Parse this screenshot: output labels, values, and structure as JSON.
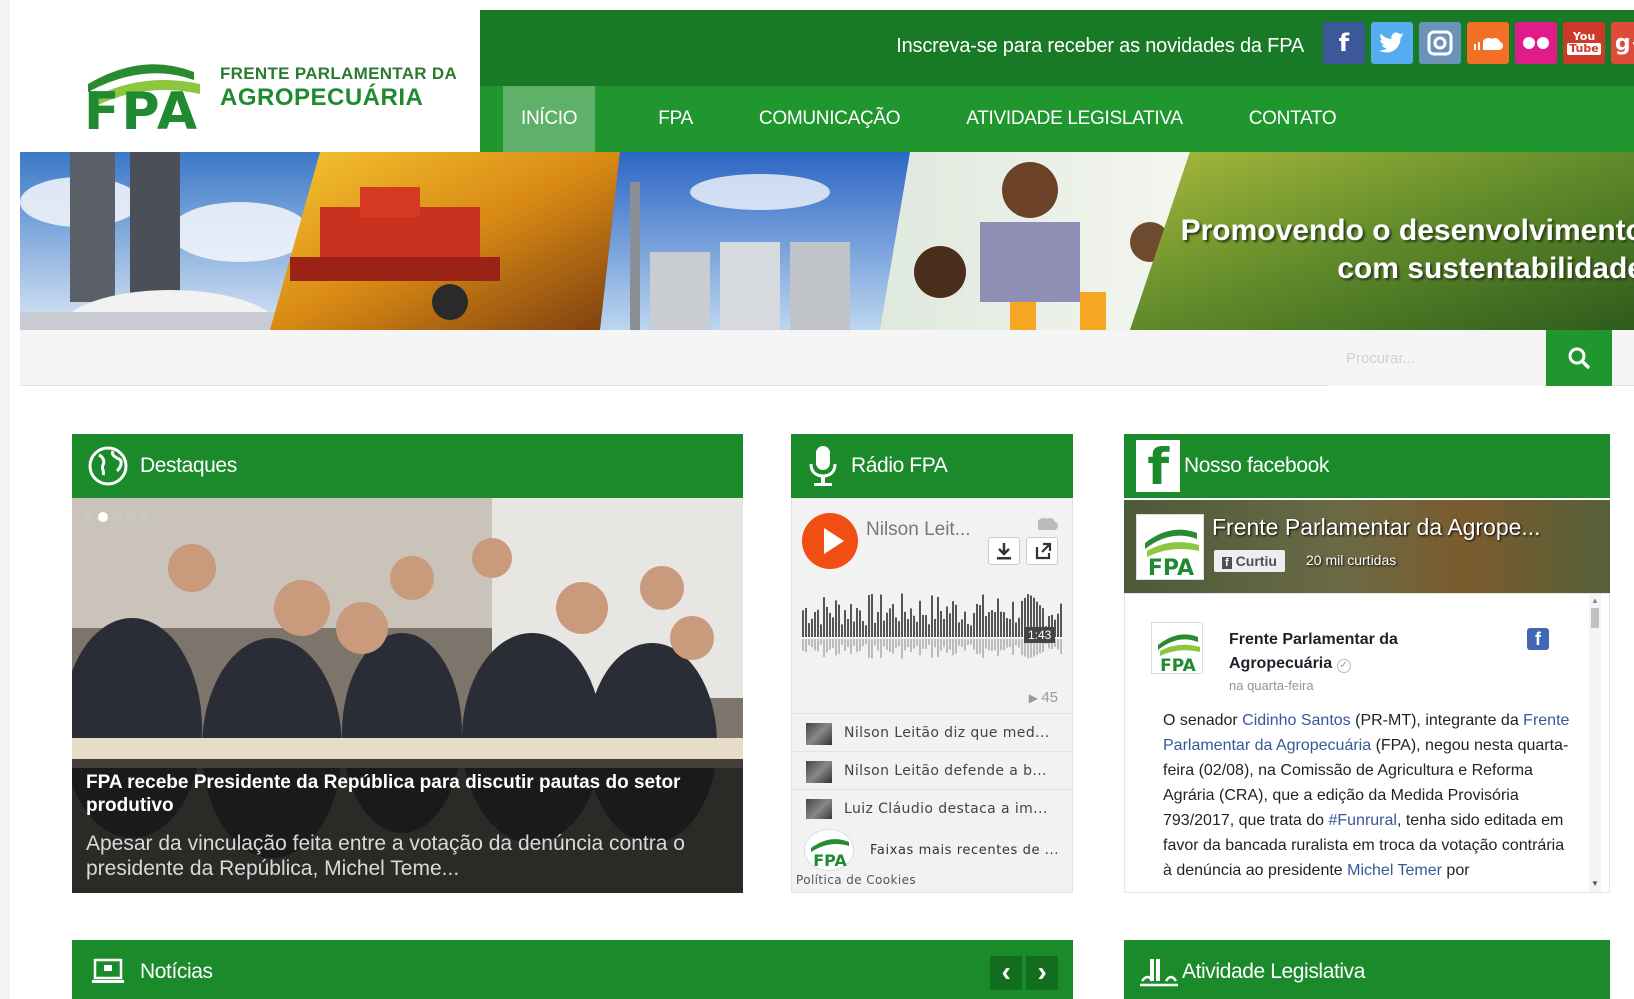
{
  "header": {
    "logo_fpa": "FPA",
    "logo_line1": "FRENTE PARLAMENTAR DA",
    "logo_line2": "AGROPECUÁRIA",
    "subscribe_text": "Inscreva-se para receber as novidades da FPA",
    "social": [
      {
        "icon": "facebook-icon",
        "glyph": "f",
        "color": "#3b5998"
      },
      {
        "icon": "twitter-icon",
        "glyph": "t",
        "color": "#55acee"
      },
      {
        "icon": "instagram-icon",
        "glyph": "◎",
        "color": "#6b93b8"
      },
      {
        "icon": "soundcloud-icon",
        "glyph": "☁",
        "color": "#f26f23"
      },
      {
        "icon": "flickr-icon",
        "glyph": "●●",
        "color": "#e01b8a"
      },
      {
        "icon": "youtube-icon",
        "glyph": "You",
        "color": "#cc3a2c"
      },
      {
        "icon": "google-plus-icon",
        "glyph": "g+",
        "color": "#dd4b39"
      }
    ]
  },
  "nav": {
    "items": [
      "INÍCIO",
      "FPA",
      "COMUNICAÇÃO",
      "ATIVIDADE LEGISLATIVA",
      "CONTATO"
    ]
  },
  "banner": {
    "tagline_line1": "Promovendo o desenvolvimento",
    "tagline_line2": "com sustentabilidade"
  },
  "search": {
    "placeholder": "Procurar..."
  },
  "destaques": {
    "title": "Destaques",
    "headline": "FPA recebe Presidente da República para discutir pautas do setor produtivo",
    "excerpt": "Apesar da vinculação feita entre a votação da denúncia contra o presidente da República, Michel Teme..."
  },
  "radio": {
    "title": "Rádio FPA",
    "artist": "Nilson Leit...",
    "duration": "1:43",
    "plays": "45",
    "tracks": [
      "Nilson Leitão diz que med...",
      "Nilson Leitão defende a b...",
      "Luiz Cláudio destaca a im..."
    ],
    "footer_label": "Faixas mais recentes de ...",
    "cookies": "Política de Cookies"
  },
  "facebook": {
    "title": "Nosso facebook",
    "cover_title": "Frente Parlamentar da Agrope...",
    "like_button": "Curtiu",
    "likes_count": "20 mil curtidas",
    "author": "Frente Parlamentar da Agropecuária",
    "author_line1": "Frente Parlamentar da",
    "author_line2": "Agropecuária",
    "time": "na quarta-feira",
    "post_parts": {
      "p1": "O senador ",
      "link1": "Cidinho Santos",
      "p2": " (PR-MT), integrante da ",
      "link2": "Frente Parlamentar da Agropecuária",
      "p3": " (FPA), negou nesta quarta-feira (02/08), na Comissão de Agricultura e Reforma Agrária (CRA), que a edição da Medida Provisória 793/2017, que trata do ",
      "link3": "#Funrural",
      "p4": ", tenha sido editada em favor da bancada ruralista em troca da votação contrária à denúncia ao presidente ",
      "link4": "Michel Temer",
      "p5": " por"
    }
  },
  "noticias": {
    "title": "Notícias",
    "prev": "‹",
    "next": "›"
  },
  "atividade": {
    "title": "Atividade Legislativa"
  },
  "colors": {
    "green_dark": "#187a26",
    "green": "#20962f",
    "panel": "#1a8a2b",
    "nav_active": "#5fb16a"
  }
}
